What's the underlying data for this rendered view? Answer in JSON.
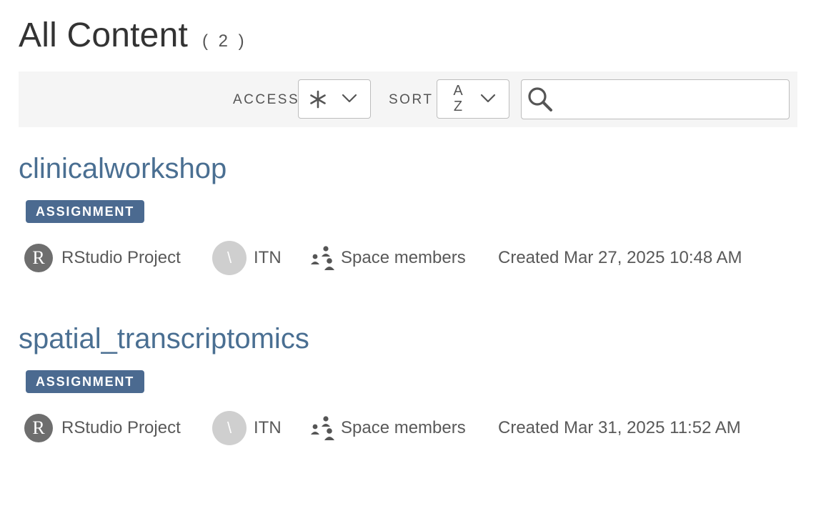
{
  "page": {
    "title": "All Content",
    "count": "( 2 )"
  },
  "toolbar": {
    "access_label": "ACCESS",
    "access_icon": "asterisk-icon",
    "sort_label": "SORT",
    "sort_icon": "sort-az-icon",
    "sort_letter_a": "A",
    "sort_letter_z": "Z",
    "search_placeholder": "",
    "search_icon": "search-icon"
  },
  "items": [
    {
      "title": "clinicalworkshop",
      "badge": "ASSIGNMENT",
      "type_letter": "R",
      "type": "RStudio Project",
      "owner_initial": "\\",
      "owner": "ITN",
      "access": "Space members",
      "created": "Created Mar 27, 2025 10:48 AM"
    },
    {
      "title": "spatial_transcriptomics",
      "badge": "ASSIGNMENT",
      "type_letter": "R",
      "type": "RStudio Project",
      "owner_initial": "\\",
      "owner": "ITN",
      "access": "Space members",
      "created": "Created Mar 31, 2025 11:52 AM"
    }
  ],
  "colors": {
    "title_link": "#4a6f92",
    "badge_bg": "#4b6a90",
    "toolbar_bg": "#f5f5f5",
    "type_circle": "#6e6e6e",
    "owner_circle": "#cfcfcf"
  }
}
